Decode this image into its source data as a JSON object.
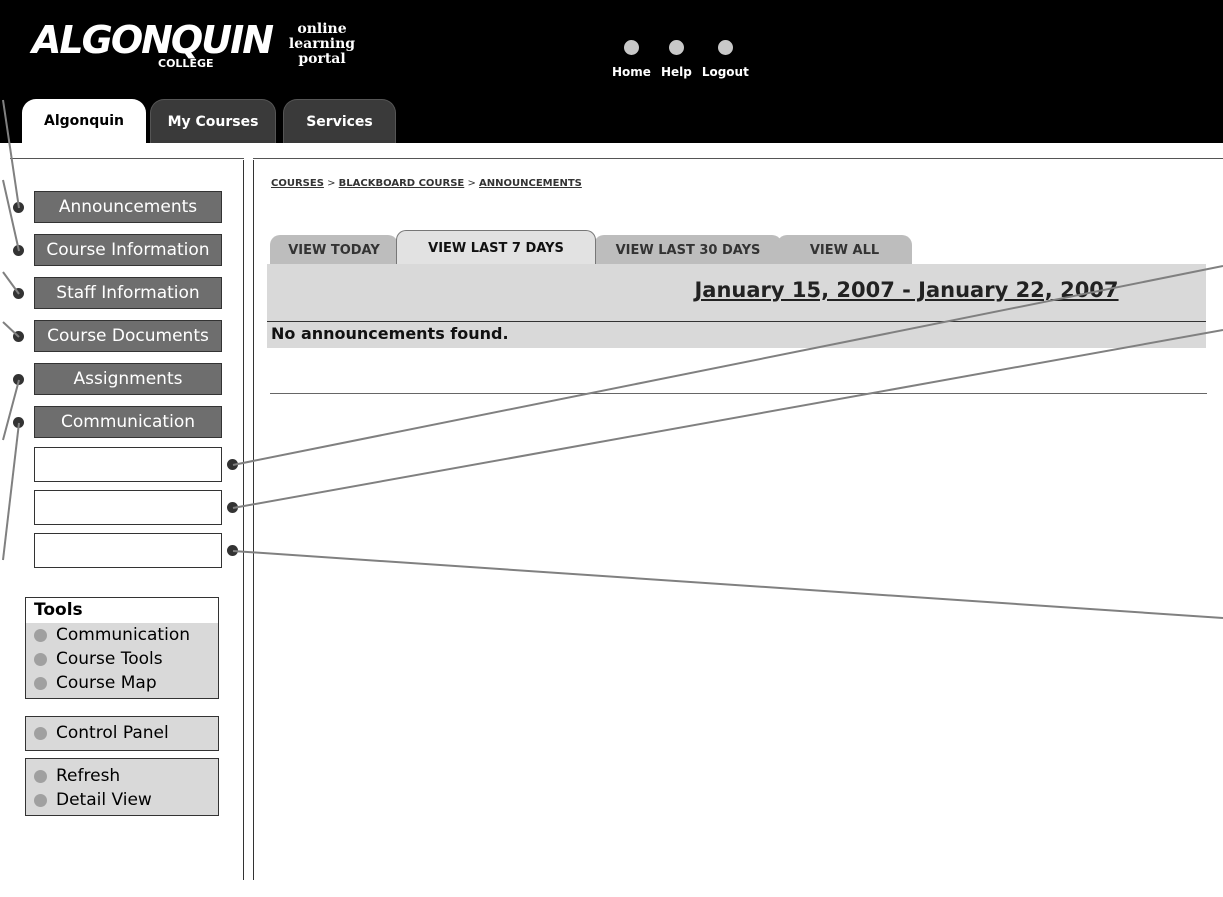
{
  "logo": {
    "main": "ALGONQUIN",
    "sub": "COLLEGE"
  },
  "portal_lines": [
    "online",
    "learning",
    "portal"
  ],
  "top_nav": [
    {
      "label": "Home",
      "icon": "home-dot-icon"
    },
    {
      "label": "Help",
      "icon": "help-dot-icon"
    },
    {
      "label": "Logout",
      "icon": "logout-dot-icon"
    }
  ],
  "main_tabs": [
    {
      "label": "Algonquin",
      "active": true
    },
    {
      "label": "My Courses",
      "active": false
    },
    {
      "label": "Services",
      "active": false
    }
  ],
  "course_menu": [
    {
      "label": "Announcements"
    },
    {
      "label": "Course Information"
    },
    {
      "label": "Staff Information"
    },
    {
      "label": "Course Documents"
    },
    {
      "label": "Assignments"
    },
    {
      "label": "Communication"
    },
    {
      "label": ""
    },
    {
      "label": ""
    },
    {
      "label": ""
    }
  ],
  "tools_panel": {
    "title": "Tools",
    "items": [
      "Communication",
      "Course Tools",
      "Course Map"
    ]
  },
  "control_panel": {
    "items": [
      "Control Panel"
    ]
  },
  "view_panel": {
    "items": [
      "Refresh",
      "Detail View"
    ]
  },
  "breadcrumb": {
    "items": [
      "COURSES",
      "BLACKBOARD COURSE",
      "ANNOUNCEMENTS"
    ],
    "separator": ">"
  },
  "view_tabs": [
    {
      "label": "VIEW TODAY",
      "active": false
    },
    {
      "label": "VIEW LAST 7 DAYS",
      "active": true
    },
    {
      "label": "VIEW LAST 30 DAYS",
      "active": false
    },
    {
      "label": "VIEW ALL",
      "active": false
    }
  ],
  "date_range": "January 15, 2007 - January 22, 2007",
  "empty_message": "No announcements found.",
  "colors": {
    "header_bg": "#000000",
    "menu_button_bg": "#6e6e6e",
    "panel_bg": "#d9d9d9",
    "annotation_line": "#808080"
  }
}
